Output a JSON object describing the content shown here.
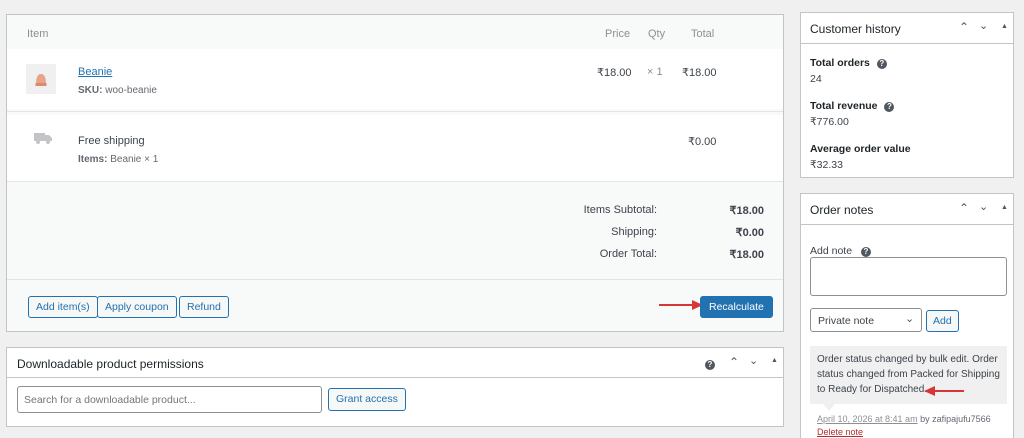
{
  "items_table": {
    "headers": {
      "item": "Item",
      "price": "Price",
      "qty": "Qty",
      "total": "Total"
    },
    "product": {
      "name": "Beanie",
      "sku_label": "SKU:",
      "sku_value": "woo-beanie",
      "price": "₹18.00",
      "qty": "× 1",
      "total": "₹18.00"
    },
    "shipping": {
      "name": "Free shipping",
      "items_label": "Items:",
      "items_value": "Beanie × 1",
      "total": "₹0.00"
    },
    "totals": [
      {
        "label": "Items Subtotal:",
        "value": "₹18.00"
      },
      {
        "label": "Shipping:",
        "value": "₹0.00"
      },
      {
        "label": "Order Total:",
        "value": "₹18.00"
      }
    ],
    "buttons": {
      "add_items": "Add item(s)",
      "apply_coupon": "Apply coupon",
      "refund": "Refund",
      "recalculate": "Recalculate"
    }
  },
  "downloadable": {
    "title": "Downloadable product permissions",
    "search_placeholder": "Search for a downloadable product...",
    "grant_access": "Grant access"
  },
  "customer_history": {
    "title": "Customer history",
    "total_orders_label": "Total orders",
    "total_orders_value": "24",
    "total_revenue_label": "Total revenue",
    "total_revenue_value": "₹776.00",
    "aov_label": "Average order value",
    "aov_value": "₹32.33"
  },
  "order_notes": {
    "title": "Order notes",
    "add_note_label": "Add note",
    "note_type_selected": "Private note",
    "add_button": "Add",
    "note_text": "Order status changed by bulk edit. Order status changed from Packed for Shipping to Ready for Dispatched.",
    "note_date": "April 10, 2026 at 8:41 am",
    "note_by": "by zafipajufu7566",
    "delete_note": "Delete note"
  },
  "colors": {
    "accent": "#2271b1",
    "arrow": "#d63638",
    "note_bg": "#f0f0f1"
  }
}
